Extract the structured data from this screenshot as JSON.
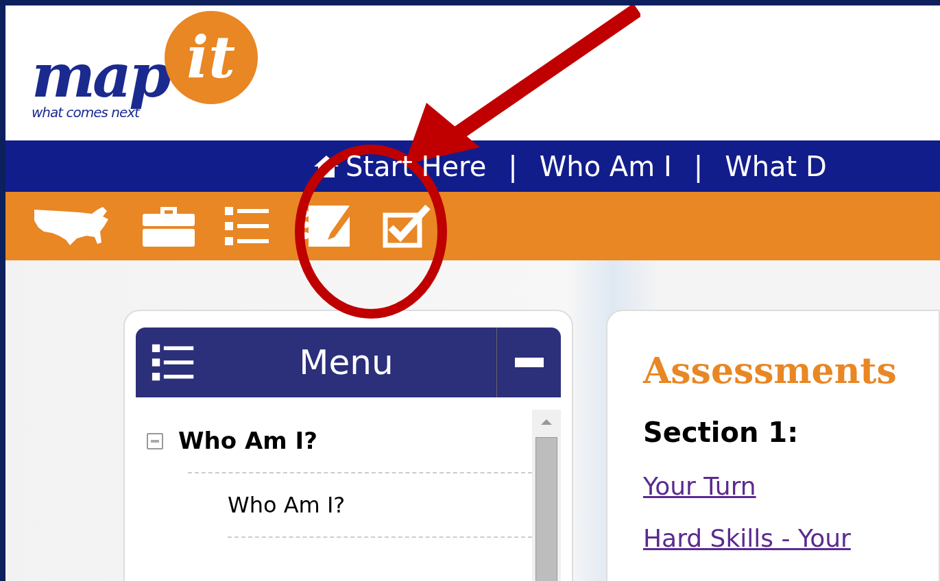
{
  "logo": {
    "word": "map",
    "tagline": "what comes next",
    "badge": "it"
  },
  "nav": [
    {
      "kind": "home",
      "label": "Start Here"
    },
    {
      "kind": "separator",
      "label": "|"
    },
    {
      "kind": "link",
      "label": "Who Am I"
    },
    {
      "kind": "separator",
      "label": "|"
    },
    {
      "kind": "link",
      "label": "What D"
    }
  ],
  "toolbar": [
    {
      "kind": "map"
    },
    {
      "kind": "briefcase"
    },
    {
      "kind": "list"
    },
    {
      "kind": "notebook"
    },
    {
      "kind": "checkbox"
    }
  ],
  "menu": {
    "title": "Menu",
    "items": [
      {
        "label": "Who Am I?",
        "expanded": true,
        "children": [
          {
            "label": "Who Am I?"
          }
        ]
      }
    ]
  },
  "content": {
    "title": "Assessments",
    "section": "Section 1:",
    "links": [
      "Your Turn",
      "Hard Skills - Your"
    ]
  }
}
